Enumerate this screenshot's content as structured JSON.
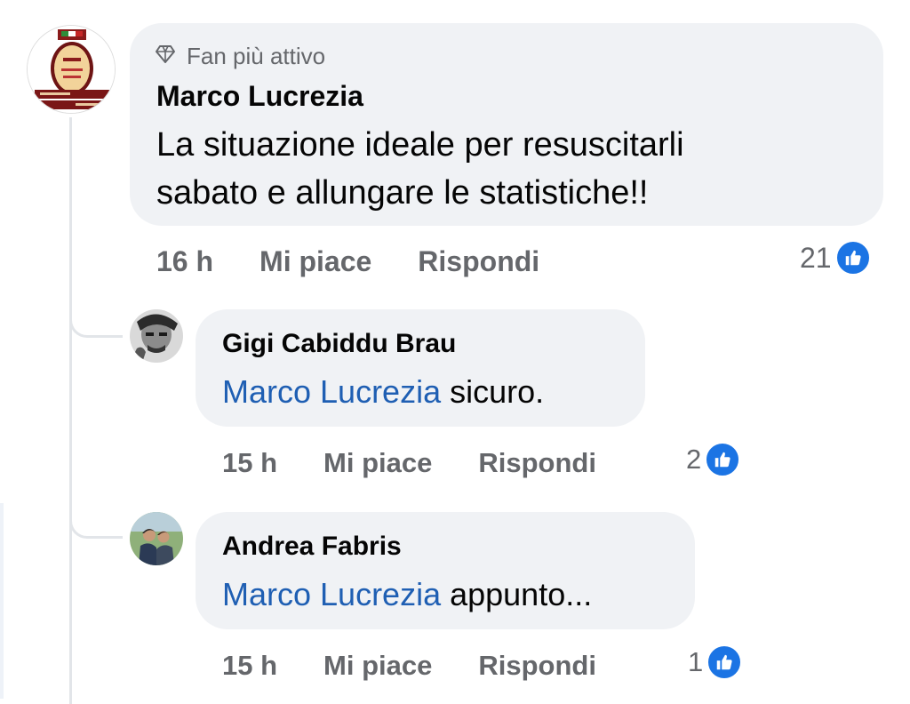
{
  "comment": {
    "badge": "Fan più attivo",
    "author": "Marco Lucrezia",
    "text_line1": "La situazione ideale per resuscitarli",
    "text_line2": "sabato e allungare le statistiche!!",
    "time": "16 h",
    "like_label": "Mi piace",
    "reply_label": "Rispondi",
    "reaction_count": "21"
  },
  "replies": [
    {
      "author": "Gigi Cabiddu Brau",
      "mention": "Marco Lucrezia",
      "text": " sicuro.",
      "time": "15 h",
      "like_label": "Mi piace",
      "reply_label": "Rispondi",
      "reaction_count": "2"
    },
    {
      "author": "Andrea Fabris",
      "mention": "Marco Lucrezia",
      "text": " appunto...",
      "time": "15 h",
      "like_label": "Mi piace",
      "reply_label": "Rispondi",
      "reaction_count": "1"
    }
  ],
  "colors": {
    "bubble": "#f0f2f5",
    "mention": "#1f5fb3",
    "meta": "#65676b",
    "like": "#1b74e4"
  },
  "icons": [
    "diamond-icon",
    "like-reaction-icon"
  ]
}
